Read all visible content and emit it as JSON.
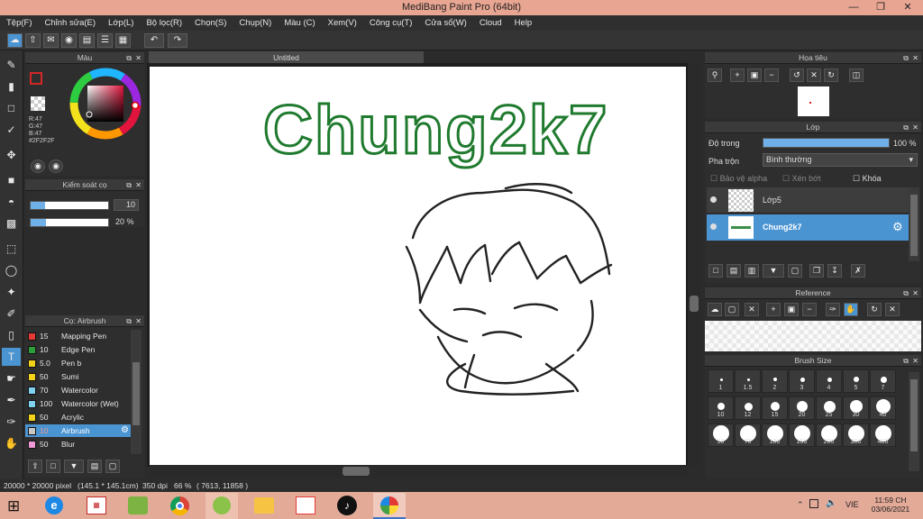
{
  "window": {
    "title": "MediBang Paint Pro (64bit)"
  },
  "menu": [
    "Tệp(F)",
    "Chỉnh sửa(E)",
    "Lớp(L)",
    "Bộ lọc(R)",
    "Chọn(S)",
    "Chụp(N)",
    "Màu (C)",
    "Xem(V)",
    "Công cụ(T)",
    "Cửa sổ(W)",
    "Cloud",
    "Help"
  ],
  "color_panel": {
    "title": "Màu",
    "r": "R:47",
    "g": "G:47",
    "b": "B:47",
    "hex": "#2F2F2F",
    "current_color": "#2f2f2f"
  },
  "size_control": {
    "title": "Kiểm soát cọ",
    "size_value": "10",
    "opacity_value": "20 %"
  },
  "brush_panel": {
    "title": "Cọ: Airbrush",
    "brushes": [
      {
        "size": "15",
        "name": "Mapping Pen",
        "color": "#e53935",
        "selected": false
      },
      {
        "size": "10",
        "name": "Edge Pen",
        "color": "#2e9e3b",
        "selected": false
      },
      {
        "size": "5.0",
        "name": "Pen b",
        "color": "#f2d21b",
        "selected": false
      },
      {
        "size": "50",
        "name": "Sumi",
        "color": "#f2d21b",
        "selected": false
      },
      {
        "size": "70",
        "name": "Watercolor",
        "color": "#7fd3f0",
        "selected": false
      },
      {
        "size": "100",
        "name": "Watercolor (Wet)",
        "color": "#7fd3f0",
        "selected": false
      },
      {
        "size": "50",
        "name": "Acrylic",
        "color": "#f2d21b",
        "selected": false
      },
      {
        "size": "10",
        "name": "Airbrush",
        "color": "#c8c8c8",
        "selected": true
      },
      {
        "size": "50",
        "name": "Blur",
        "color": "#ef9ad6",
        "selected": false
      }
    ]
  },
  "document": {
    "tab": "Untitled",
    "canvas_text": "Chung2k7"
  },
  "navigator": {
    "title": "Họa tiêu"
  },
  "layer_panel": {
    "title": "Lớp",
    "opacity_label": "Độ trong",
    "opacity_value": "100 %",
    "opacity": 1.0,
    "blend_label": "Pha trộn",
    "blend_value": "Bình thường",
    "protect_alpha": "Bảo vệ alpha",
    "clipping": "Xén bớt",
    "lock": "Khóa",
    "layers": [
      {
        "name": "Lớp5",
        "selected": false
      },
      {
        "name": "Chung2k7",
        "selected": true
      }
    ]
  },
  "reference_panel": {
    "title": "Reference"
  },
  "brush_size_panel": {
    "title": "Brush Size",
    "sizes": [
      "1",
      "1.5",
      "2",
      "3",
      "4",
      "5",
      "7",
      "10",
      "12",
      "15",
      "20",
      "25",
      "30",
      "40",
      "50",
      "70",
      "100",
      "150",
      "200",
      "300",
      "400"
    ]
  },
  "status": {
    "dimensions": "20000 * 20000 pixel",
    "physical": "(145.1 * 145.1cm)",
    "dpi": "350 dpi",
    "zoom": "66 %",
    "coords": "( 7613, 11858 )"
  },
  "taskbar": {
    "lang": "VIE",
    "time": "11:59 CH",
    "date": "03/06/2021"
  }
}
